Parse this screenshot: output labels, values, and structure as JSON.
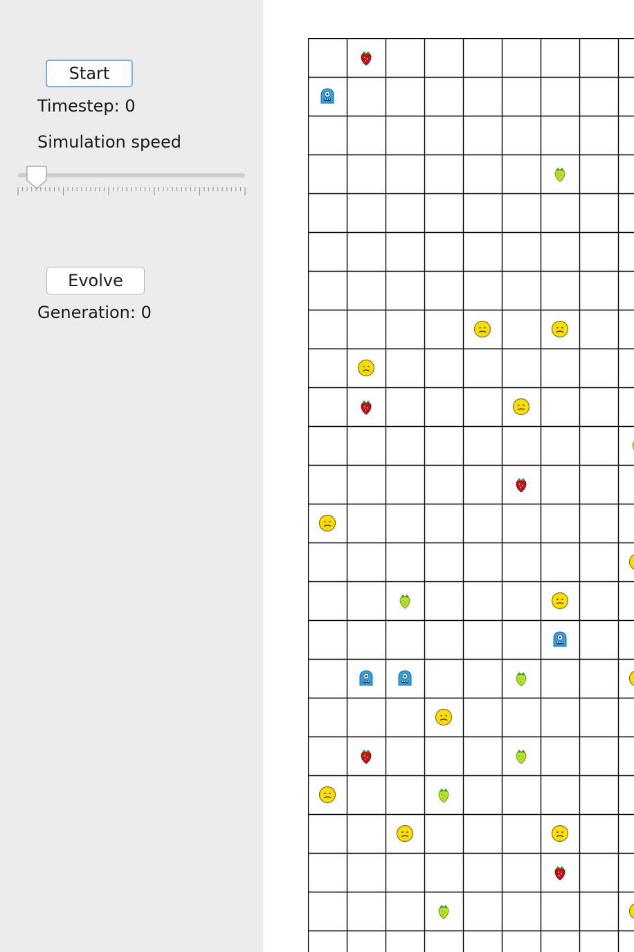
{
  "controls": {
    "start_label": "Start",
    "timestep_label": "Timestep: 0",
    "speed_label": "Simulation speed",
    "speed_level": 0.1,
    "evolve_label": "Evolve",
    "generation_label": "Generation: 0"
  },
  "grid": {
    "cell_icons": {
      "smiley": "smiley-icon",
      "red": "red-strawberry-icon",
      "green": "green-strawberry-icon",
      "blue": "blue-creature-icon"
    },
    "colors": {
      "smiley": "#f7dd0a",
      "red": "#c0141c",
      "green": "#b5e22b",
      "blue": "#2fa3e0",
      "line": "#000000"
    },
    "items": [
      {
        "row": 0,
        "col": 1,
        "type": "red"
      },
      {
        "row": 1,
        "col": 0,
        "type": "blue"
      },
      {
        "row": 3,
        "col": 6,
        "type": "green"
      },
      {
        "row": 7,
        "col": 4,
        "type": "smiley"
      },
      {
        "row": 7,
        "col": 6,
        "type": "smiley"
      },
      {
        "row": 8,
        "col": 1,
        "type": "smiley"
      },
      {
        "row": 9,
        "col": 1,
        "type": "red"
      },
      {
        "row": 9,
        "col": 5,
        "type": "smiley"
      },
      {
        "row": 10,
        "col": 8,
        "type": "green"
      },
      {
        "row": 11,
        "col": 5,
        "type": "red"
      },
      {
        "row": 12,
        "col": 0,
        "type": "smiley"
      },
      {
        "row": 13,
        "col": 8,
        "type": "smiley"
      },
      {
        "row": 14,
        "col": 2,
        "type": "green"
      },
      {
        "row": 14,
        "col": 6,
        "type": "smiley"
      },
      {
        "row": 15,
        "col": 6,
        "type": "blue"
      },
      {
        "row": 16,
        "col": 1,
        "type": "blue"
      },
      {
        "row": 16,
        "col": 2,
        "type": "blue"
      },
      {
        "row": 16,
        "col": 5,
        "type": "green"
      },
      {
        "row": 16,
        "col": 8,
        "type": "smiley"
      },
      {
        "row": 17,
        "col": 3,
        "type": "smiley"
      },
      {
        "row": 18,
        "col": 1,
        "type": "red"
      },
      {
        "row": 18,
        "col": 5,
        "type": "green"
      },
      {
        "row": 19,
        "col": 0,
        "type": "smiley"
      },
      {
        "row": 19,
        "col": 3,
        "type": "green"
      },
      {
        "row": 20,
        "col": 2,
        "type": "smiley"
      },
      {
        "row": 20,
        "col": 6,
        "type": "smiley"
      },
      {
        "row": 21,
        "col": 6,
        "type": "red"
      },
      {
        "row": 22,
        "col": 3,
        "type": "green"
      },
      {
        "row": 22,
        "col": 8,
        "type": "smiley"
      }
    ]
  }
}
